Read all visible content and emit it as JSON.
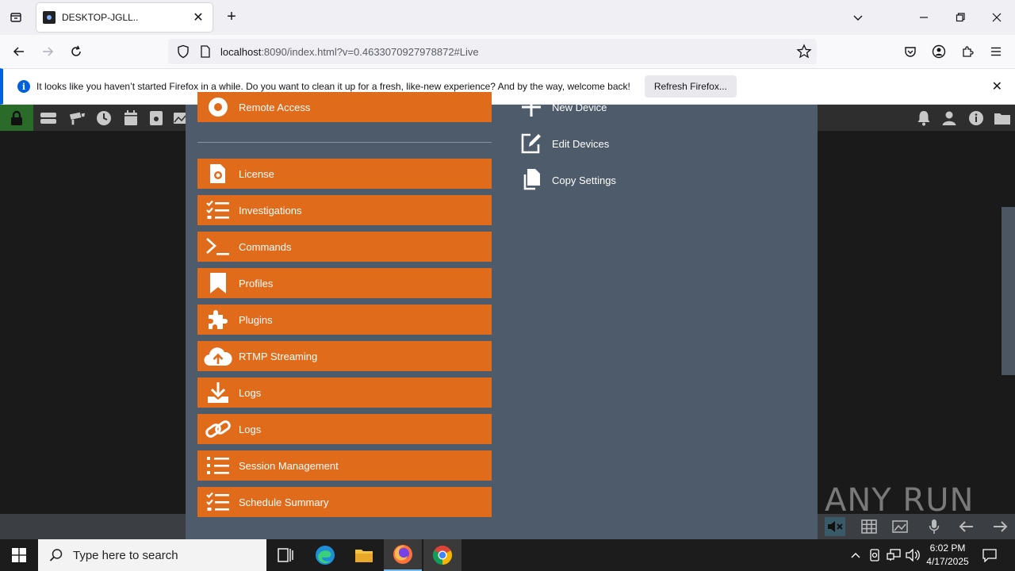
{
  "browser": {
    "tab_title": "DESKTOP-JGLL..",
    "url_host": "localhost",
    "url_rest": ":8090/index.html?v=0.4633070927978872#Live",
    "notification": "It looks like you haven’t started Firefox in a while. Do you want to clean it up for a fresh, like-new experience? And by the way, welcome back!",
    "refresh_button": "Refresh Firefox..."
  },
  "menu": {
    "top_partial": "Remote Access",
    "items": [
      {
        "label": "License",
        "icon": "license-icon"
      },
      {
        "label": "Investigations",
        "icon": "checklist-icon"
      },
      {
        "label": "Commands",
        "icon": "terminal-icon"
      },
      {
        "label": "Profiles",
        "icon": "bookmark-icon"
      },
      {
        "label": "Plugins",
        "icon": "puzzle-icon"
      },
      {
        "label": "RTMP Streaming",
        "icon": "cloud-upload-icon"
      },
      {
        "label": "Logs",
        "icon": "download-icon"
      },
      {
        "label": "Logs",
        "icon": "link-icon"
      },
      {
        "label": "Session Management",
        "icon": "list-icon"
      },
      {
        "label": "Schedule Summary",
        "icon": "checklist-icon"
      }
    ]
  },
  "side_actions": {
    "new_device": "New Device",
    "edit_devices": "Edit Devices",
    "copy_settings": "Copy Settings"
  },
  "watermark": "ANY RUN",
  "taskbar": {
    "search_placeholder": "Type here to search",
    "time": "6:02 PM",
    "date": "4/17/2025"
  },
  "colors": {
    "menu_button": "#e06b1b",
    "modal_bg": "#4d5b6b"
  }
}
